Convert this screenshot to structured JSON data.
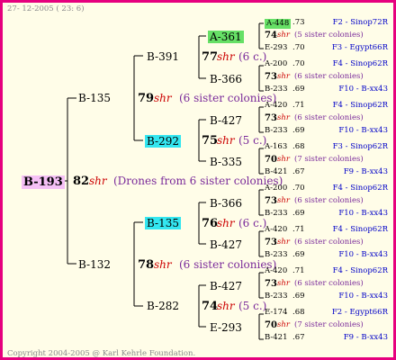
{
  "date": "27- 12-2005 ( 23: 6)",
  "copyright": "Copyright 2004-2005 @ Karl Kehrle Foundation.",
  "colors": {
    "border": "#e6007e",
    "background": "#fffde8",
    "pink_highlight": "#f5c0f5",
    "green_highlight": "#66e066",
    "cyan_highlight": "#33e6f0"
  },
  "root": {
    "id": "B-193",
    "num": "82",
    "shr": "shr",
    "note": "(Drones from 6 sister colonies)"
  },
  "gen1": {
    "top": "B-135",
    "bottom": "B-132"
  },
  "gen2": {
    "top": {
      "num": "79",
      "shr": "shr",
      "note": "(6 sister colonies)"
    },
    "bottom": {
      "num": "78",
      "shr": "shr",
      "note": "(6 sister colonies)"
    }
  },
  "gen3": [
    {
      "id": "B-391"
    },
    {
      "id": "B-292"
    },
    {
      "id": "B-135"
    },
    {
      "id": "B-282"
    }
  ],
  "gen4": [
    {
      "num": "77",
      "shr": "shr",
      "note": "(6 c.)"
    },
    {
      "num": "75",
      "shr": "shr",
      "note": "(5 c.)"
    },
    {
      "num": "76",
      "shr": "shr",
      "note": "(6 c.)"
    },
    {
      "num": "74",
      "shr": "shr",
      "note": "(5 c.)"
    }
  ],
  "gen5": [
    "A-361",
    "B-366",
    "B-427",
    "B-335",
    "B-366",
    "B-427",
    "B-427",
    "E-293"
  ],
  "gen6": [
    {
      "top": {
        "id": "A-448",
        "val": ".73",
        "origin": "F2 - Sinop72R"
      },
      "mid": {
        "num": "74",
        "shr": "shr",
        "note": "(5 sister colonies)"
      },
      "bot": {
        "id": "E-293",
        "val": ".70",
        "origin": "F3 - Egypt66R"
      }
    },
    {
      "top": {
        "id": "A-200",
        "val": ".70",
        "origin": "F4 - Sinop62R"
      },
      "mid": {
        "num": "73",
        "shr": "shr",
        "note": "(6 sister colonies)"
      },
      "bot": {
        "id": "B-233",
        "val": ".69",
        "origin": "F10 - B-xx43"
      }
    },
    {
      "top": {
        "id": "A-420",
        "val": ".71",
        "origin": "F4 - Sinop62R"
      },
      "mid": {
        "num": "73",
        "shr": "shr",
        "note": "(6 sister colonies)"
      },
      "bot": {
        "id": "B-233",
        "val": ".69",
        "origin": "F10 - B-xx43"
      }
    },
    {
      "top": {
        "id": "A-163",
        "val": ".68",
        "origin": "F3 - Sinop62R"
      },
      "mid": {
        "num": "70",
        "shr": "shr",
        "note": "(7 sister colonies)"
      },
      "bot": {
        "id": "B-421",
        "val": ".67",
        "origin": "F9 - B-xx43"
      }
    },
    {
      "top": {
        "id": "A-200",
        "val": ".70",
        "origin": "F4 - Sinop62R"
      },
      "mid": {
        "num": "73",
        "shr": "shr",
        "note": "(6 sister colonies)"
      },
      "bot": {
        "id": "B-233",
        "val": ".69",
        "origin": "F10 - B-xx43"
      }
    },
    {
      "top": {
        "id": "A-420",
        "val": ".71",
        "origin": "F4 - Sinop62R"
      },
      "mid": {
        "num": "73",
        "shr": "shr",
        "note": "(6 sister colonies)"
      },
      "bot": {
        "id": "B-233",
        "val": ".69",
        "origin": "F10 - B-xx43"
      }
    },
    {
      "top": {
        "id": "A-420",
        "val": ".71",
        "origin": "F4 - Sinop62R"
      },
      "mid": {
        "num": "73",
        "shr": "shr",
        "note": "(6 sister colonies)"
      },
      "bot": {
        "id": "B-233",
        "val": ".69",
        "origin": "F10 - B-xx43"
      }
    },
    {
      "top": {
        "id": "E-174",
        "val": ".68",
        "origin": "F2 - Egypt66R"
      },
      "mid": {
        "num": "70",
        "shr": "shr",
        "note": "(7 sister colonies)"
      },
      "bot": {
        "id": "B-421",
        "val": ".67",
        "origin": "F9 - B-xx43"
      }
    }
  ]
}
